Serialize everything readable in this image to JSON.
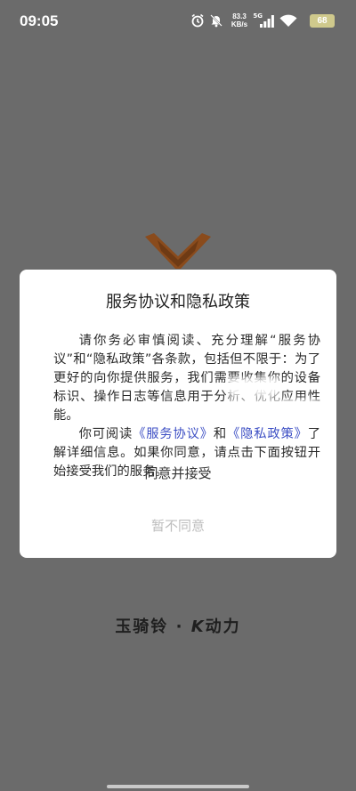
{
  "status_bar": {
    "time": "09:05",
    "net_speed_value": "83.3",
    "net_speed_unit": "KB/s",
    "signal_label": "5G",
    "battery": "68"
  },
  "dialog": {
    "title": "服务协议和隐私政策",
    "paragraph1": "请你务必审慎阅读、充分理解“服务协议”和“隐私政策”各条款，包括但不限于：为了更好的向你提供服务，我们需要收集你的设备标识、操作日志等信息用于分析、优化应用性能。",
    "p2_prefix": "你可阅读",
    "p2_link1": "《服务协议》",
    "p2_mid": "和",
    "p2_link2": "《隐私政策》",
    "p2_suffix": "了解详细信息。如果你同意，请点击下面按钮开始接受我们的服务。",
    "agree_label": "同意并接受",
    "disagree_label": "暂不同意"
  },
  "brand": {
    "name": "玉骑铃",
    "separator": "·",
    "k_letter": "K",
    "suffix": "动力"
  },
  "colors": {
    "overlay": "#6b6b6b",
    "link": "#3d4fc4",
    "logo": "#8a4b1c",
    "battery": "#cfc98c"
  }
}
